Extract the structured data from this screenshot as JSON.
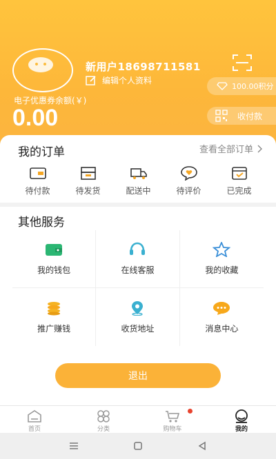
{
  "profile": {
    "username": "新用户18698711581",
    "edit_label": "编辑个人资料",
    "points_label": "100.00积分",
    "pay_label": "收付款",
    "coupon_label": "电子优惠券余额(￥)",
    "coupon_amount": "0.00"
  },
  "orders": {
    "title": "我的订单",
    "view_all": "查看全部订单",
    "items": [
      {
        "label": "待付款",
        "icon": "wallet-card-icon"
      },
      {
        "label": "待发货",
        "icon": "box-print-icon"
      },
      {
        "label": "配送中",
        "icon": "truck-icon"
      },
      {
        "label": "待评价",
        "icon": "heart-chat-icon"
      },
      {
        "label": "已完成",
        "icon": "check-box-icon"
      }
    ]
  },
  "services": {
    "title": "其他服务",
    "items": [
      {
        "label": "我的钱包",
        "icon": "wallet-icon"
      },
      {
        "label": "在线客服",
        "icon": "headset-icon"
      },
      {
        "label": "我的收藏",
        "icon": "star-icon"
      },
      {
        "label": "推广赚钱",
        "icon": "coins-icon"
      },
      {
        "label": "收货地址",
        "icon": "location-pin-icon"
      },
      {
        "label": "消息中心",
        "icon": "chat-bubble-icon"
      }
    ]
  },
  "logout_label": "退出",
  "tabs": [
    {
      "label": "首页",
      "icon": "home-icon"
    },
    {
      "label": "分类",
      "icon": "category-icon"
    },
    {
      "label": "购物车",
      "icon": "cart-icon"
    },
    {
      "label": "我的",
      "icon": "profile-icon",
      "active": true
    }
  ],
  "colors": {
    "brand": "#fbb238",
    "badge": "#e8442f",
    "wallet": "#2bb673",
    "headset": "#3ab0d0",
    "star": "#3a8fd8"
  }
}
